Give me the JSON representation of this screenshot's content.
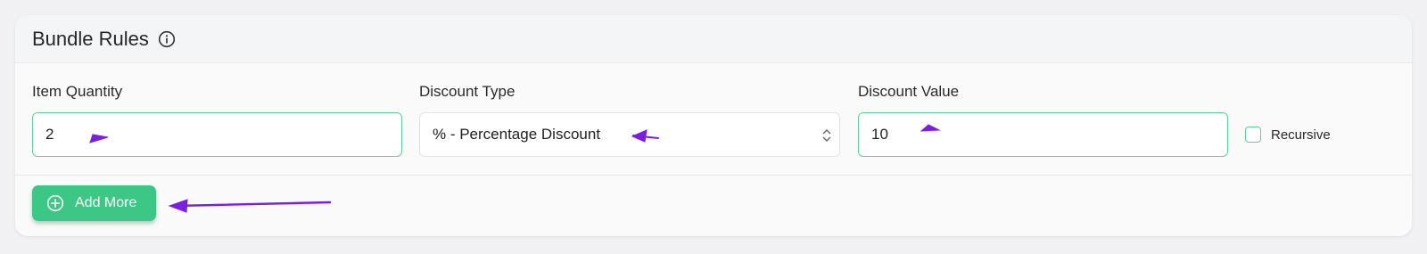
{
  "panel": {
    "title": "Bundle Rules",
    "info_icon": "info-icon"
  },
  "fields": {
    "item_quantity": {
      "label": "Item Quantity",
      "value": "2"
    },
    "discount_type": {
      "label": "Discount Type",
      "value": "% - Percentage Discount"
    },
    "discount_value": {
      "label": "Discount Value",
      "value": "10"
    }
  },
  "recursive": {
    "label": "Recursive",
    "checked": false
  },
  "add_more": {
    "label": "Add More",
    "icon": "plus-circle-icon"
  },
  "annotations": {
    "arrow_color": "#7a1fe0"
  },
  "colors": {
    "accent": "#3dc786",
    "input_border": "#5fd19a"
  }
}
